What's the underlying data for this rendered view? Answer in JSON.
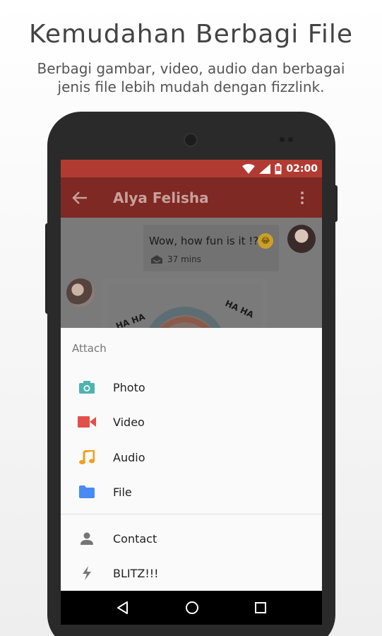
{
  "promo": {
    "title": "Kemudahan Berbagi File",
    "subtitle_line1": "Berbagi gambar, video, audio dan berbagai",
    "subtitle_line2": "jenis file lebih mudah dengan fizzlink."
  },
  "status_bar": {
    "time": "02:00"
  },
  "app_bar": {
    "title": "Alya Felisha"
  },
  "chat": {
    "outgoing_message": "Wow, how fun is it !?",
    "outgoing_time": "37 mins"
  },
  "attach_sheet": {
    "title": "Attach",
    "items": [
      {
        "label": "Photo",
        "icon": "camera-icon",
        "color": "#4fb3b0"
      },
      {
        "label": "Video",
        "icon": "videocam-icon",
        "color": "#e2504a"
      },
      {
        "label": "Audio",
        "icon": "music-note-icon",
        "color": "#f29c1f"
      },
      {
        "label": "File",
        "icon": "folder-icon",
        "color": "#4a8af4"
      },
      {
        "label": "Contact",
        "icon": "person-icon",
        "color": "#757575"
      },
      {
        "label": "BLITZ!!!",
        "icon": "lightning-icon",
        "color": "#757575"
      }
    ]
  },
  "colors": {
    "status_bar": "#b13b32",
    "app_bar": "#7e2923"
  }
}
